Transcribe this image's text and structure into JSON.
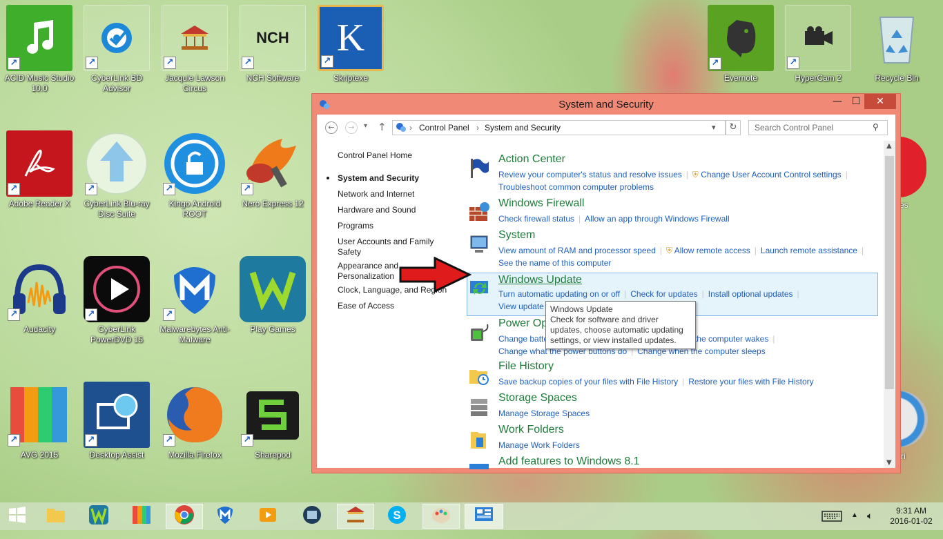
{
  "desktop": {
    "icons": [
      {
        "label": "ACID Music Studio 10.0",
        "icon": "music-note-icon"
      },
      {
        "label": "CyberLink BD Advisor",
        "icon": "disc-check-icon"
      },
      {
        "label": "Jacquie Lawson Circus",
        "icon": "carousel-icon"
      },
      {
        "label": "NCH Software",
        "icon": "nch-logo-icon"
      },
      {
        "label": "Skriptexe",
        "icon": "k5-icon"
      },
      {
        "label": "Evernote",
        "icon": "elephant-icon"
      },
      {
        "label": "HyperCam 2",
        "icon": "camera-icon"
      },
      {
        "label": "Recycle Bin",
        "icon": "recycle-bin-icon"
      },
      {
        "label": "Adobe Reader X",
        "icon": "pdf-icon"
      },
      {
        "label": "CyberLink Blu-ray Disc Suite",
        "icon": "upload-arrow-icon"
      },
      {
        "label": "Kingo Android ROOT",
        "icon": "unlock-icon"
      },
      {
        "label": "Nero Express 12",
        "icon": "flame-icon"
      },
      {
        "label": "Audacity",
        "icon": "headphones-icon"
      },
      {
        "label": "CyberLink PowerDVD 15",
        "icon": "play-icon"
      },
      {
        "label": "Malwarebytes Anti-Malware",
        "icon": "shield-m-icon"
      },
      {
        "label": "Play Games",
        "icon": "games-icon"
      },
      {
        "label": "AVG 2015",
        "icon": "avg-icon"
      },
      {
        "label": "Desktop Assist",
        "icon": "desktop-assist-icon"
      },
      {
        "label": "Mozilla Firefox",
        "icon": "firefox-icon"
      },
      {
        "label": "Sharepod",
        "icon": "sharepod-icon"
      }
    ],
    "partial_label": "es",
    "partial_label_2": "ri"
  },
  "window": {
    "title": "System and Security",
    "minimize": "—",
    "maximize": "☐",
    "close": "✕",
    "address": {
      "root": "Control Panel",
      "current": "System and Security"
    },
    "search_placeholder": "Search Control Panel",
    "left_nav": [
      "Control Panel Home",
      "System and Security",
      "Network and Internet",
      "Hardware and Sound",
      "Programs",
      "User Accounts and Family Safety",
      "Appearance and Personalization",
      "Clock, Language, and Region",
      "Ease of Access"
    ],
    "sections": [
      {
        "title": "Action Center",
        "links": [
          "Review your computer's status and resolve issues",
          "Change User Account Control settings",
          "Troubleshoot common computer problems"
        ]
      },
      {
        "title": "Windows Firewall",
        "links": [
          "Check firewall status",
          "Allow an app through Windows Firewall"
        ]
      },
      {
        "title": "System",
        "links": [
          "View amount of RAM and processor speed",
          "Allow remote access",
          "Launch remote assistance",
          "See the name of this computer"
        ]
      },
      {
        "title": "Windows Update",
        "links": [
          "Turn automatic updating on or off",
          "Check for updates",
          "Install optional updates",
          "View update history"
        ]
      },
      {
        "title": "Power Options",
        "links": [
          "Change battery settings",
          "Require a password when the computer wakes",
          "Change what the power buttons do",
          "Change when the computer sleeps"
        ]
      },
      {
        "title": "File History",
        "links": [
          "Save backup copies of your files with File History",
          "Restore your files with File History"
        ]
      },
      {
        "title": "Storage Spaces",
        "links": [
          "Manage Storage Spaces"
        ]
      },
      {
        "title": "Work Folders",
        "links": [
          "Manage Work Folders"
        ]
      },
      {
        "title": "Add features to Windows 8.1",
        "links": []
      }
    ]
  },
  "tooltip": {
    "title": "Windows Update",
    "body": "Check for software and driver updates, choose automatic updating settings, or view installed updates."
  },
  "taskbar": {
    "time": "9:31 AM",
    "date": "2016-01-02"
  },
  "colors": {
    "window_frame": "#f08a76",
    "link": "#1e5fbf",
    "heading": "#1e7b3a",
    "highlight": "#e5f3fb"
  }
}
